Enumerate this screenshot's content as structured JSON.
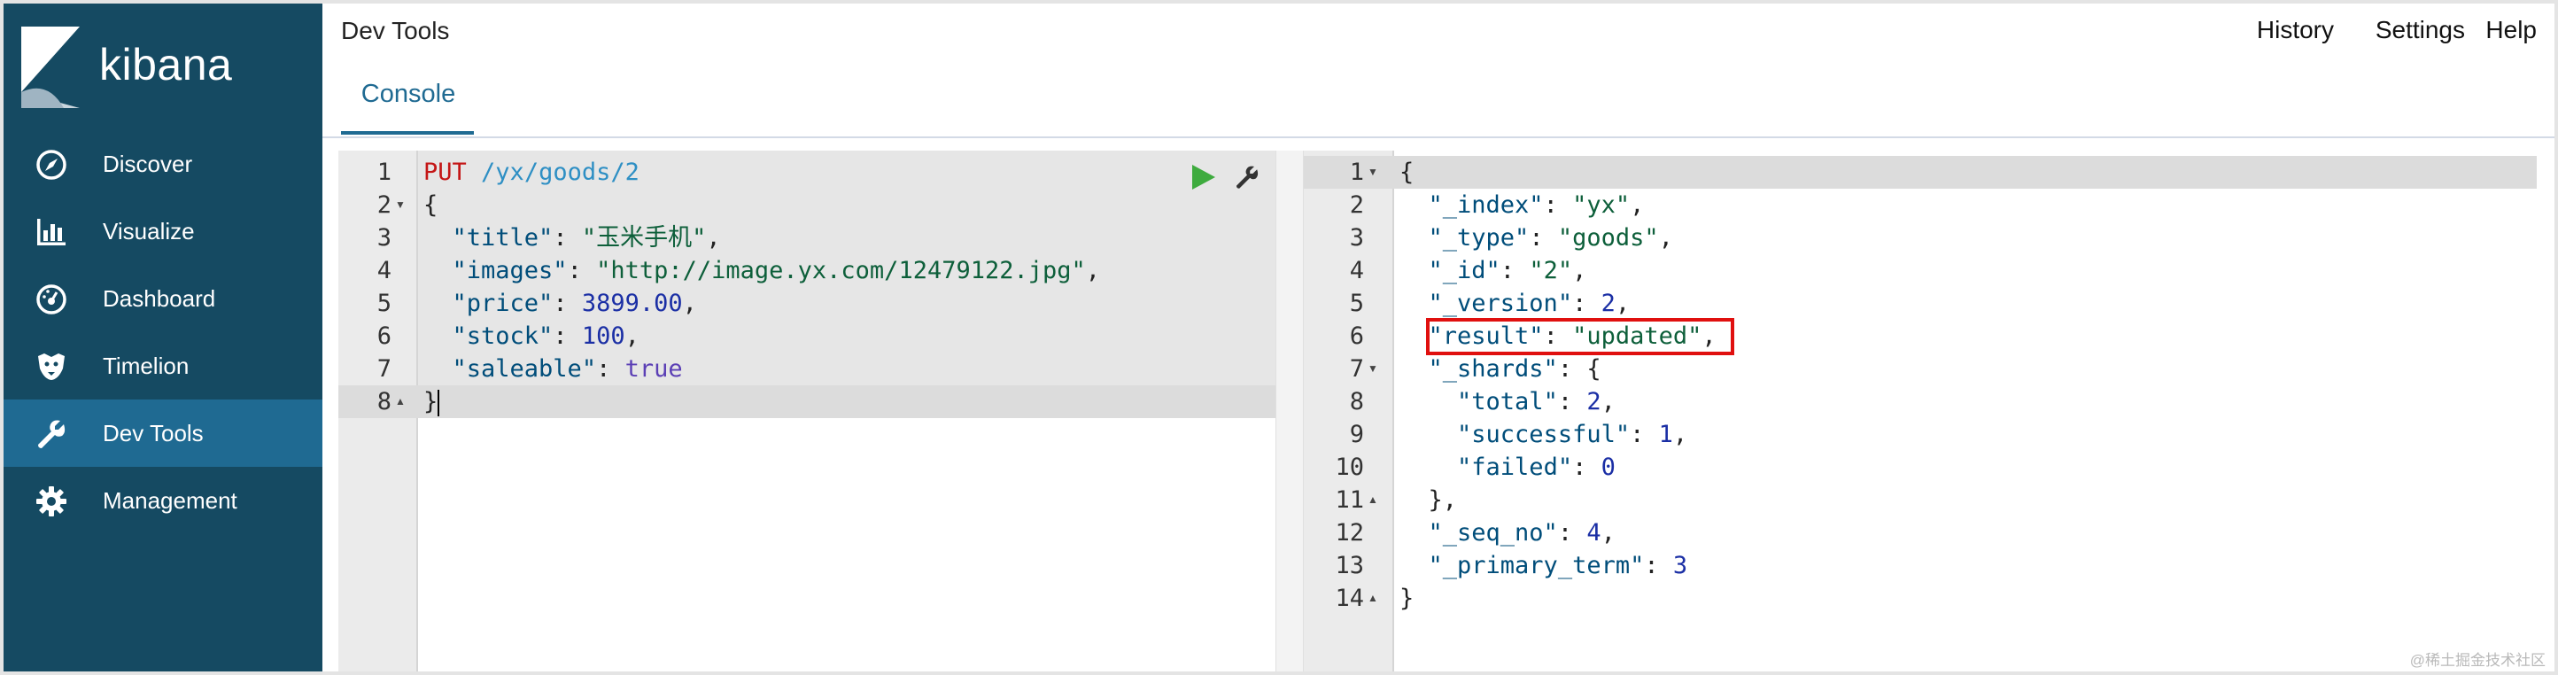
{
  "app": {
    "brand": "kibana",
    "title": "Dev Tools"
  },
  "header": {
    "links": [
      "History",
      "Settings",
      "Help"
    ],
    "tab_console": "Console"
  },
  "sidebar": {
    "items": [
      {
        "label": "Discover",
        "icon": "compass-icon"
      },
      {
        "label": "Visualize",
        "icon": "bar-chart-icon"
      },
      {
        "label": "Dashboard",
        "icon": "dashboard-icon"
      },
      {
        "label": "Timelion",
        "icon": "timelion-icon"
      },
      {
        "label": "Dev Tools",
        "icon": "wrench-icon",
        "active": true
      },
      {
        "label": "Management",
        "icon": "gear-icon"
      }
    ]
  },
  "request": {
    "method": "PUT",
    "path": "/yx/goods/2",
    "lines": [
      {
        "n": "1",
        "parts": [
          [
            "m",
            "PUT"
          ],
          [
            "p",
            " "
          ],
          [
            "u",
            "/yx/goods/2"
          ]
        ]
      },
      {
        "n": "2",
        "parts": [
          [
            "p",
            "{"
          ]
        ]
      },
      {
        "n": "3",
        "parts": [
          [
            "p",
            "  "
          ],
          [
            "k",
            "\"title\""
          ],
          [
            "p",
            ": "
          ],
          [
            "s",
            "\"玉米手机\""
          ],
          [
            "p",
            ","
          ]
        ]
      },
      {
        "n": "4",
        "parts": [
          [
            "p",
            "  "
          ],
          [
            "k",
            "\"images\""
          ],
          [
            "p",
            ": "
          ],
          [
            "s",
            "\"http://image.yx.com/12479122.jpg\""
          ],
          [
            "p",
            ","
          ]
        ]
      },
      {
        "n": "5",
        "parts": [
          [
            "p",
            "  "
          ],
          [
            "k",
            "\"price\""
          ],
          [
            "p",
            ": "
          ],
          [
            "n",
            "3899.00"
          ],
          [
            "p",
            ","
          ]
        ]
      },
      {
        "n": "6",
        "parts": [
          [
            "p",
            "  "
          ],
          [
            "k",
            "\"stock\""
          ],
          [
            "p",
            ": "
          ],
          [
            "n",
            "100"
          ],
          [
            "p",
            ","
          ]
        ]
      },
      {
        "n": "7",
        "parts": [
          [
            "p",
            "  "
          ],
          [
            "k",
            "\"saleable\""
          ],
          [
            "p",
            ": "
          ],
          [
            "kw",
            "true"
          ]
        ]
      },
      {
        "n": "8",
        "parts": [
          [
            "p",
            "}"
          ]
        ]
      }
    ]
  },
  "response": {
    "lines": [
      {
        "n": "1",
        "parts": [
          [
            "p",
            "{"
          ]
        ]
      },
      {
        "n": "2",
        "parts": [
          [
            "p",
            "  "
          ],
          [
            "k",
            "\"_index\""
          ],
          [
            "p",
            ": "
          ],
          [
            "s",
            "\"yx\""
          ],
          [
            "p",
            ","
          ]
        ]
      },
      {
        "n": "3",
        "parts": [
          [
            "p",
            "  "
          ],
          [
            "k",
            "\"_type\""
          ],
          [
            "p",
            ": "
          ],
          [
            "s",
            "\"goods\""
          ],
          [
            "p",
            ","
          ]
        ]
      },
      {
        "n": "4",
        "parts": [
          [
            "p",
            "  "
          ],
          [
            "k",
            "\"_id\""
          ],
          [
            "p",
            ": "
          ],
          [
            "s",
            "\"2\""
          ],
          [
            "p",
            ","
          ]
        ]
      },
      {
        "n": "5",
        "parts": [
          [
            "p",
            "  "
          ],
          [
            "k",
            "\"_version\""
          ],
          [
            "p",
            ": "
          ],
          [
            "n",
            "2"
          ],
          [
            "p",
            ","
          ]
        ]
      },
      {
        "n": "6",
        "parts": [
          [
            "p",
            "  "
          ],
          [
            "k",
            "\"result\""
          ],
          [
            "p",
            ": "
          ],
          [
            "s",
            "\"updated\""
          ],
          [
            "p",
            ","
          ]
        ]
      },
      {
        "n": "7",
        "parts": [
          [
            "p",
            "  "
          ],
          [
            "k",
            "\"_shards\""
          ],
          [
            "p",
            ": {"
          ]
        ]
      },
      {
        "n": "8",
        "parts": [
          [
            "p",
            "    "
          ],
          [
            "k",
            "\"total\""
          ],
          [
            "p",
            ": "
          ],
          [
            "n",
            "2"
          ],
          [
            "p",
            ","
          ]
        ]
      },
      {
        "n": "9",
        "parts": [
          [
            "p",
            "    "
          ],
          [
            "k",
            "\"successful\""
          ],
          [
            "p",
            ": "
          ],
          [
            "n",
            "1"
          ],
          [
            "p",
            ","
          ]
        ]
      },
      {
        "n": "10",
        "parts": [
          [
            "p",
            "    "
          ],
          [
            "k",
            "\"failed\""
          ],
          [
            "p",
            ": "
          ],
          [
            "n",
            "0"
          ]
        ]
      },
      {
        "n": "11",
        "parts": [
          [
            "p",
            "  },"
          ]
        ]
      },
      {
        "n": "12",
        "parts": [
          [
            "p",
            "  "
          ],
          [
            "k",
            "\"_seq_no\""
          ],
          [
            "p",
            ": "
          ],
          [
            "n",
            "4"
          ],
          [
            "p",
            ","
          ]
        ]
      },
      {
        "n": "13",
        "parts": [
          [
            "p",
            "  "
          ],
          [
            "k",
            "\"_primary_term\""
          ],
          [
            "p",
            ": "
          ],
          [
            "n",
            "3"
          ]
        ]
      },
      {
        "n": "14",
        "parts": [
          [
            "p",
            "}"
          ]
        ]
      }
    ]
  },
  "watermark": "@稀土掘金技术社区",
  "colors": {
    "sidebar": "#154a62",
    "active": "#1f6a92",
    "highlight": "#e0100f",
    "play": "#3eab3e"
  }
}
